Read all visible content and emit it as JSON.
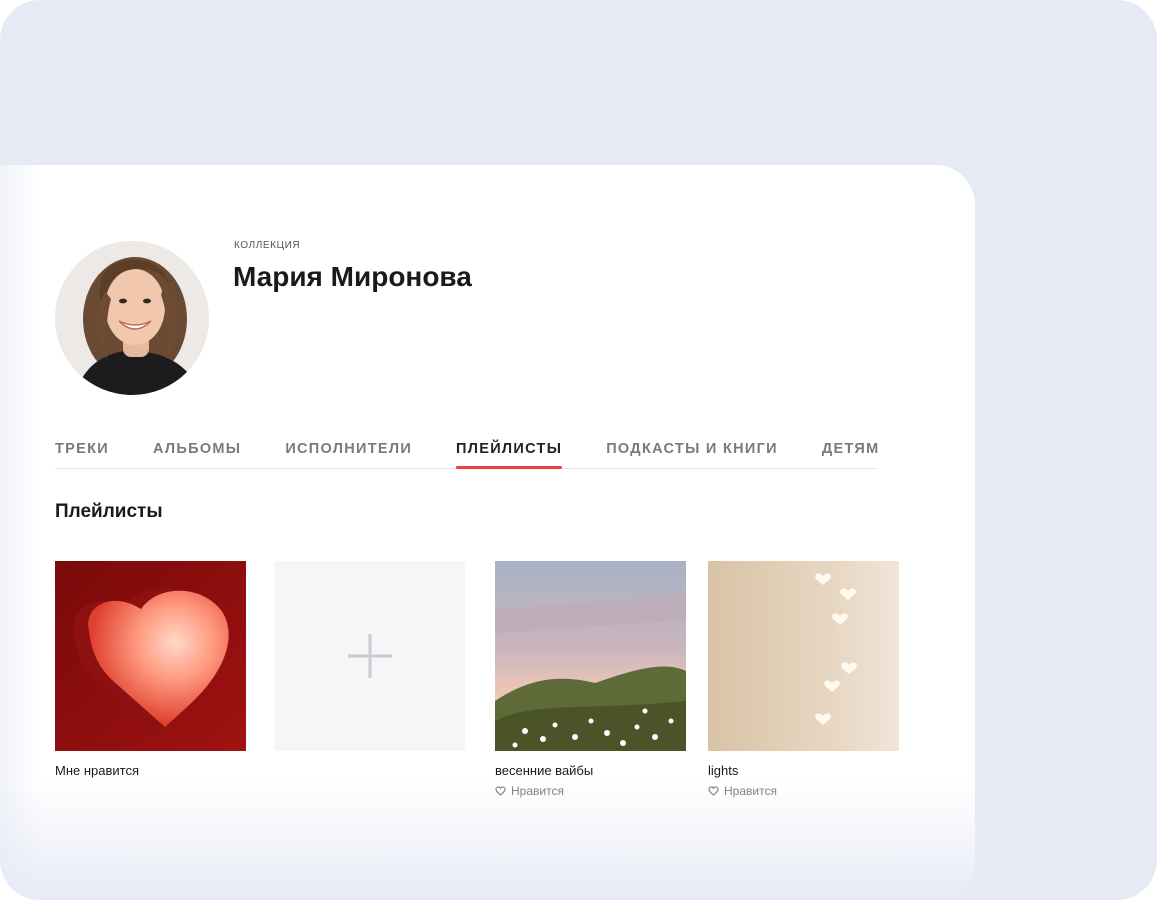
{
  "header": {
    "collection_label": "Коллекция",
    "name": "Мария Миронова"
  },
  "tabs": [
    {
      "label": "ТРЕКИ",
      "active": false
    },
    {
      "label": "АЛЬБОМЫ",
      "active": false
    },
    {
      "label": "ИСПОЛНИТЕЛИ",
      "active": false
    },
    {
      "label": "ПЛЕЙЛИСТЫ",
      "active": true
    },
    {
      "label": "ПОДКАСТЫ И КНИГИ",
      "active": false
    },
    {
      "label": "ДЕТЯМ",
      "active": false
    }
  ],
  "section_title": "Плейлисты",
  "playlists": [
    {
      "title": "Мне нравится",
      "icon": "heart-cover"
    },
    {
      "title": "",
      "icon": "plus-icon"
    },
    {
      "title": "весенние вайбы",
      "meta": "Нравится",
      "icon": "heart-outline-icon"
    },
    {
      "title": "lights",
      "meta": "Нравится",
      "icon": "heart-outline-icon"
    }
  ],
  "colors": {
    "accent": "#f03d3d",
    "backdrop": "#e6eaf5"
  }
}
